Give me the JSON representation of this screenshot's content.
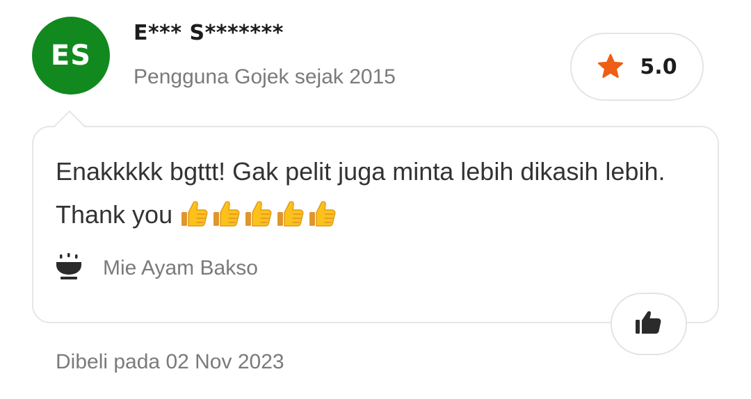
{
  "reviewer": {
    "initials": "ES",
    "name": "E*** S*******",
    "member_since": "Pengguna Gojek sejak 2015",
    "avatar_color": "#12891f"
  },
  "rating": {
    "value": "5.0",
    "icon": "star-icon",
    "star_color": "#ee5e14"
  },
  "review": {
    "text": "Enakkkkk bgttt! Gak pelit juga minta lebih dikasih lebih. Thank you",
    "emojis": [
      "thumbs-up-icon",
      "thumbs-up-icon",
      "thumbs-up-icon",
      "thumbs-up-icon",
      "thumbs-up-icon"
    ]
  },
  "dish": {
    "icon": "bowl-icon",
    "name": "Mie Ayam Bakso"
  },
  "like_button": {
    "icon": "thumbs-up-icon"
  },
  "purchase": {
    "date_text": "Dibeli pada 02 Nov 2023"
  }
}
